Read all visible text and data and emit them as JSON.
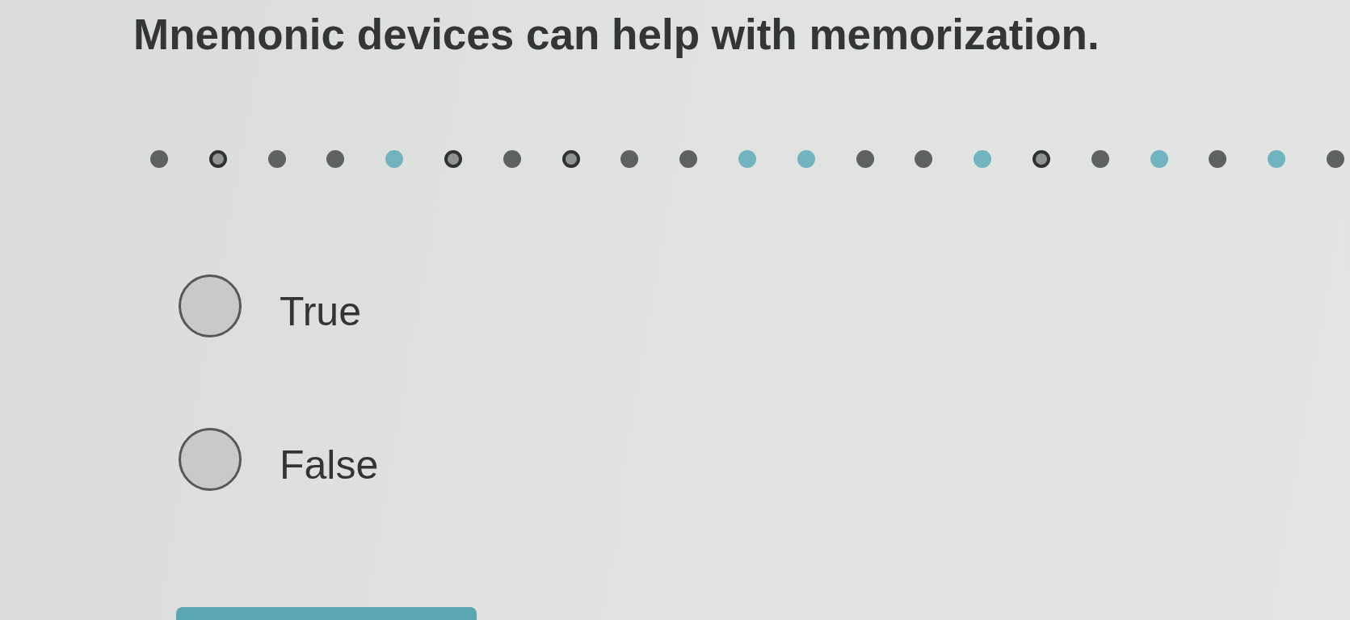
{
  "question": {
    "text": "Mnemonic devices can help with memorization."
  },
  "progress_dots": [
    {
      "kind": "dot",
      "color": "#5e6162"
    },
    {
      "kind": "ring"
    },
    {
      "kind": "dot",
      "color": "#5e6162"
    },
    {
      "kind": "dot",
      "color": "#5e6162"
    },
    {
      "kind": "dot",
      "color": "#72b3c0"
    },
    {
      "kind": "ring"
    },
    {
      "kind": "dot",
      "color": "#5e6162"
    },
    {
      "kind": "ring"
    },
    {
      "kind": "dot",
      "color": "#5e6162"
    },
    {
      "kind": "dot",
      "color": "#5e6162"
    },
    {
      "kind": "dot",
      "color": "#72b3c0"
    },
    {
      "kind": "dot",
      "color": "#72b3c0"
    },
    {
      "kind": "dot",
      "color": "#5e6162"
    },
    {
      "kind": "dot",
      "color": "#5e6162"
    },
    {
      "kind": "dot",
      "color": "#72b3c0"
    },
    {
      "kind": "ring"
    },
    {
      "kind": "dot",
      "color": "#5e6162"
    },
    {
      "kind": "dot",
      "color": "#72b3c0"
    },
    {
      "kind": "dot",
      "color": "#5e6162"
    },
    {
      "kind": "dot",
      "color": "#72b3c0"
    },
    {
      "kind": "dot",
      "color": "#5e6162"
    }
  ],
  "options": [
    {
      "label": "True",
      "selected": false
    },
    {
      "label": "False",
      "selected": false
    }
  ]
}
